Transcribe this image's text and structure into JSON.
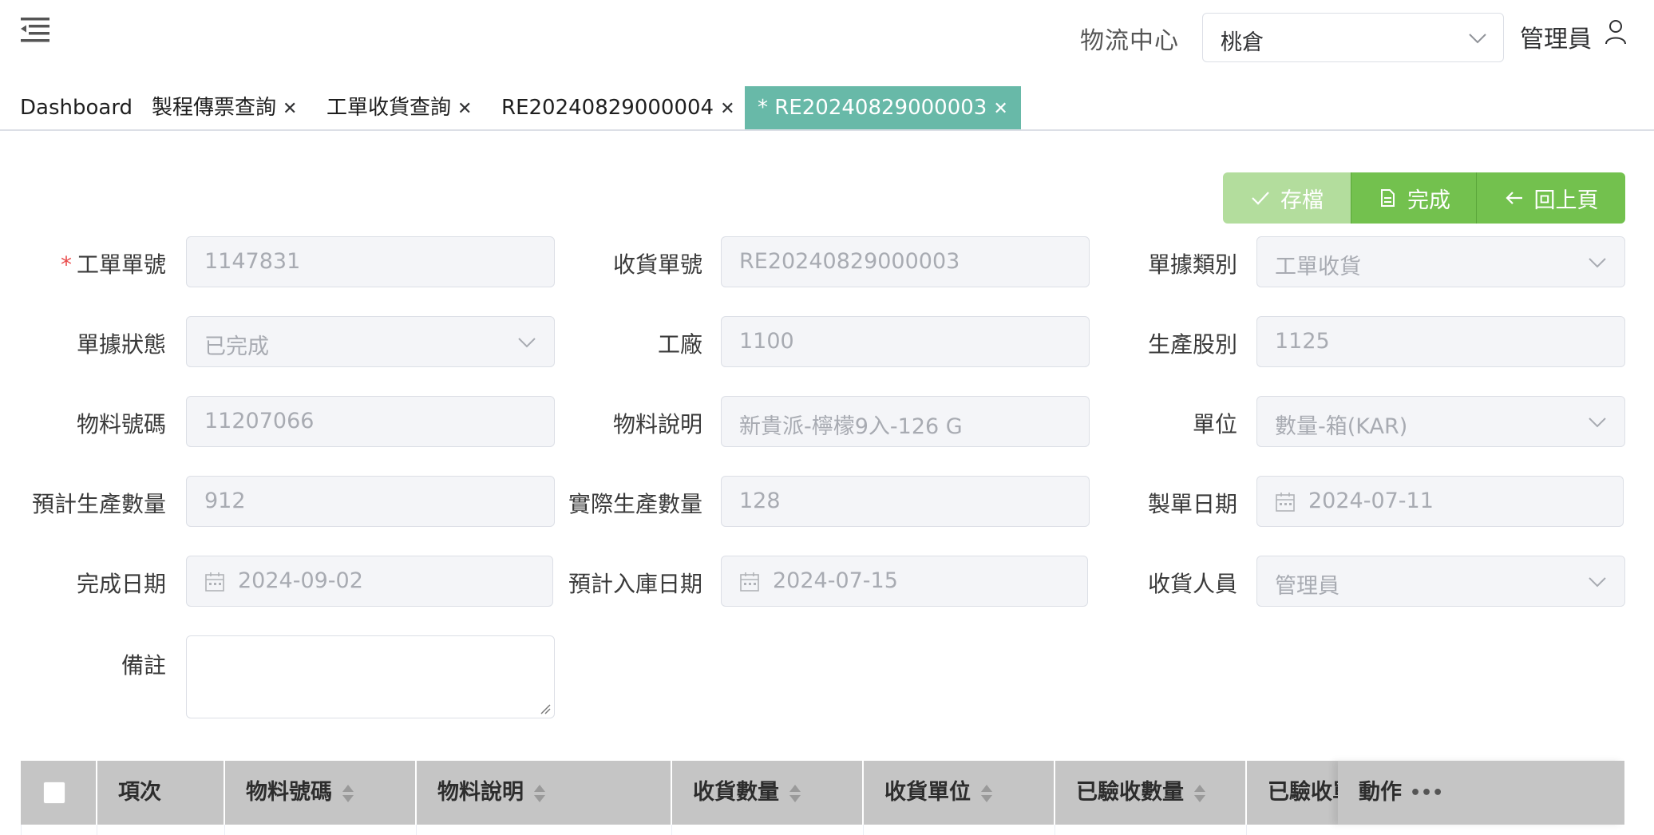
{
  "header": {
    "center_label": "物流中心",
    "warehouse_value": "桃倉",
    "user_label": "管理員"
  },
  "tabs": [
    {
      "label": "Dashboard",
      "closable": false
    },
    {
      "label": "製程傳票查詢",
      "closable": true
    },
    {
      "label": "工單收貨查詢",
      "closable": true
    },
    {
      "label": "RE20240829000004",
      "closable": true
    },
    {
      "label": "* RE20240829000003",
      "closable": true,
      "active": true
    }
  ],
  "actions": {
    "save": "存檔",
    "done": "完成",
    "back": "回上頁"
  },
  "form": {
    "work_order_no": {
      "label": "工單單號",
      "value": "1147831",
      "required": true
    },
    "receipt_no": {
      "label": "收貨單號",
      "value": "RE20240829000003"
    },
    "doc_type": {
      "label": "單據類別",
      "value": "工單收貨"
    },
    "doc_status": {
      "label": "單據狀態",
      "value": "已完成"
    },
    "factory": {
      "label": "工廠",
      "value": "1100"
    },
    "prod_section": {
      "label": "生產股別",
      "value": "1125"
    },
    "material_no": {
      "label": "物料號碼",
      "value": "11207066"
    },
    "material_desc": {
      "label": "物料說明",
      "value": "新貴派-檸檬9入-126 G"
    },
    "unit": {
      "label": "單位",
      "value": "數量-箱(KAR)"
    },
    "planned_qty": {
      "label": "預計生產數量",
      "value": "912"
    },
    "actual_qty": {
      "label": "實際生產數量",
      "value": "128"
    },
    "order_date": {
      "label": "製單日期",
      "value": "2024-07-11"
    },
    "complete_date": {
      "label": "完成日期",
      "value": "2024-09-02"
    },
    "planned_stock_date": {
      "label": "預計入庫日期",
      "value": "2024-07-15"
    },
    "receiver": {
      "label": "收貨人員",
      "value": "管理員"
    },
    "remark": {
      "label": "備註",
      "value": ""
    }
  },
  "table": {
    "columns": [
      "項次",
      "物料號碼",
      "物料說明",
      "收貨數量",
      "收貨單位",
      "已驗收數量",
      "已驗收單位"
    ],
    "action_column": "動作",
    "action_menu_icon": "ellipsis-icon"
  },
  "colors": {
    "active_tab": "#68b9a8",
    "primary_green": "#73c14e",
    "disabled_green": "#b3dd9d",
    "required": "#e94b4b"
  }
}
